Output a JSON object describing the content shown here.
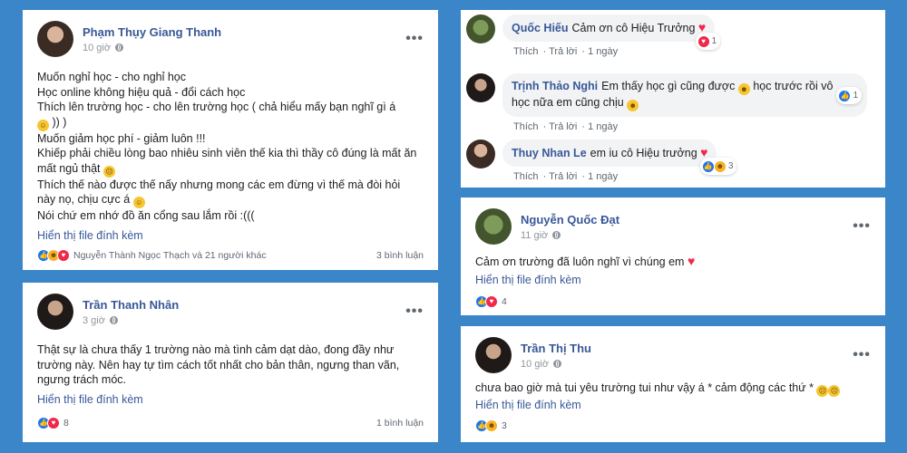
{
  "post1": {
    "author": "Phạm Thụy Giang Thanh",
    "time": "10 giờ",
    "lines": [
      "Muốn nghỉ học - cho nghỉ học",
      "Học online không hiệu quả - đổi cách học",
      "Thích lên trường học - cho lên trường học ( chả hiểu mấy bạn nghĩ gì á",
      "Muốn giảm học phí - giảm luôn !!!",
      "Khiếp phải chiều lòng bao nhiêu sinh viên thế kia thì thầy cô đúng là mất ăn",
      "mất ngủ thật",
      "Thích thế nào được thế nấy nhưng mong các em đừng vì thế mà đòi hỏi",
      "này nọ, chịu cực á",
      "Nói chứ em nhớ đồ ăn cổng sau lắm rồi :((("
    ],
    "line3_tail": ")) )",
    "attach": "Hiển thị file đính kèm",
    "reactors": "Nguyễn Thành Ngọc Thạch và 21 người khác",
    "comments": "3 bình luận"
  },
  "post2": {
    "author": "Trần Thanh Nhân",
    "time": "3 giờ",
    "lines": [
      "Thật sự là chưa thấy 1 trường nào mà tình cảm dạt dào, đong đầy như",
      "trường này. Nên hay tự tìm cách tốt nhất cho bản thân, ngưng than vãn,",
      "ngưng trách móc."
    ],
    "attach": "Hiển thị file đính kèm",
    "count": "8",
    "comments": "1 bình luận"
  },
  "comment1": {
    "author": "Quốc Hiếu",
    "text": "Cảm ơn cô Hiệu Trưởng",
    "like": "Thích",
    "reply": "Trả lời",
    "time": "1 ngày",
    "react_count": "1"
  },
  "comment2": {
    "author": "Trịnh Thảo Nghi",
    "text1": "Em thấy học gì cũng được",
    "text2": "học trước rồi vô",
    "text3": "học nữa em cũng chịu",
    "like": "Thích",
    "reply": "Trả lời",
    "time": "1 ngày",
    "react_count": "1"
  },
  "comment3": {
    "author": "Thuy Nhan Le",
    "text": "em iu cô Hiệu trưởng",
    "like": "Thích",
    "reply": "Trả lời",
    "time": "1 ngày",
    "react_count": "3"
  },
  "post3": {
    "author": "Nguyễn Quốc Đạt",
    "time": "11 giờ",
    "text": "Cảm ơn trường đã luôn nghĩ vì chúng em",
    "attach": "Hiển thị file đính kèm",
    "count": "4"
  },
  "post4": {
    "author": "Trần Thị Thu",
    "time": "10 giờ",
    "text": "chưa bao giờ mà tui yêu trường tui như vậy á * cảm động các thứ *",
    "attach": "Hiển thị file đính kèm",
    "count": "3"
  },
  "colors": {
    "background": "#3b86c8",
    "link": "#385898",
    "like": "#1877f2",
    "love": "#f0284a"
  },
  "icons": [
    "globe-icon",
    "more-icon",
    "like-icon",
    "love-icon",
    "haha-icon",
    "sad-icon",
    "heart-icon"
  ]
}
